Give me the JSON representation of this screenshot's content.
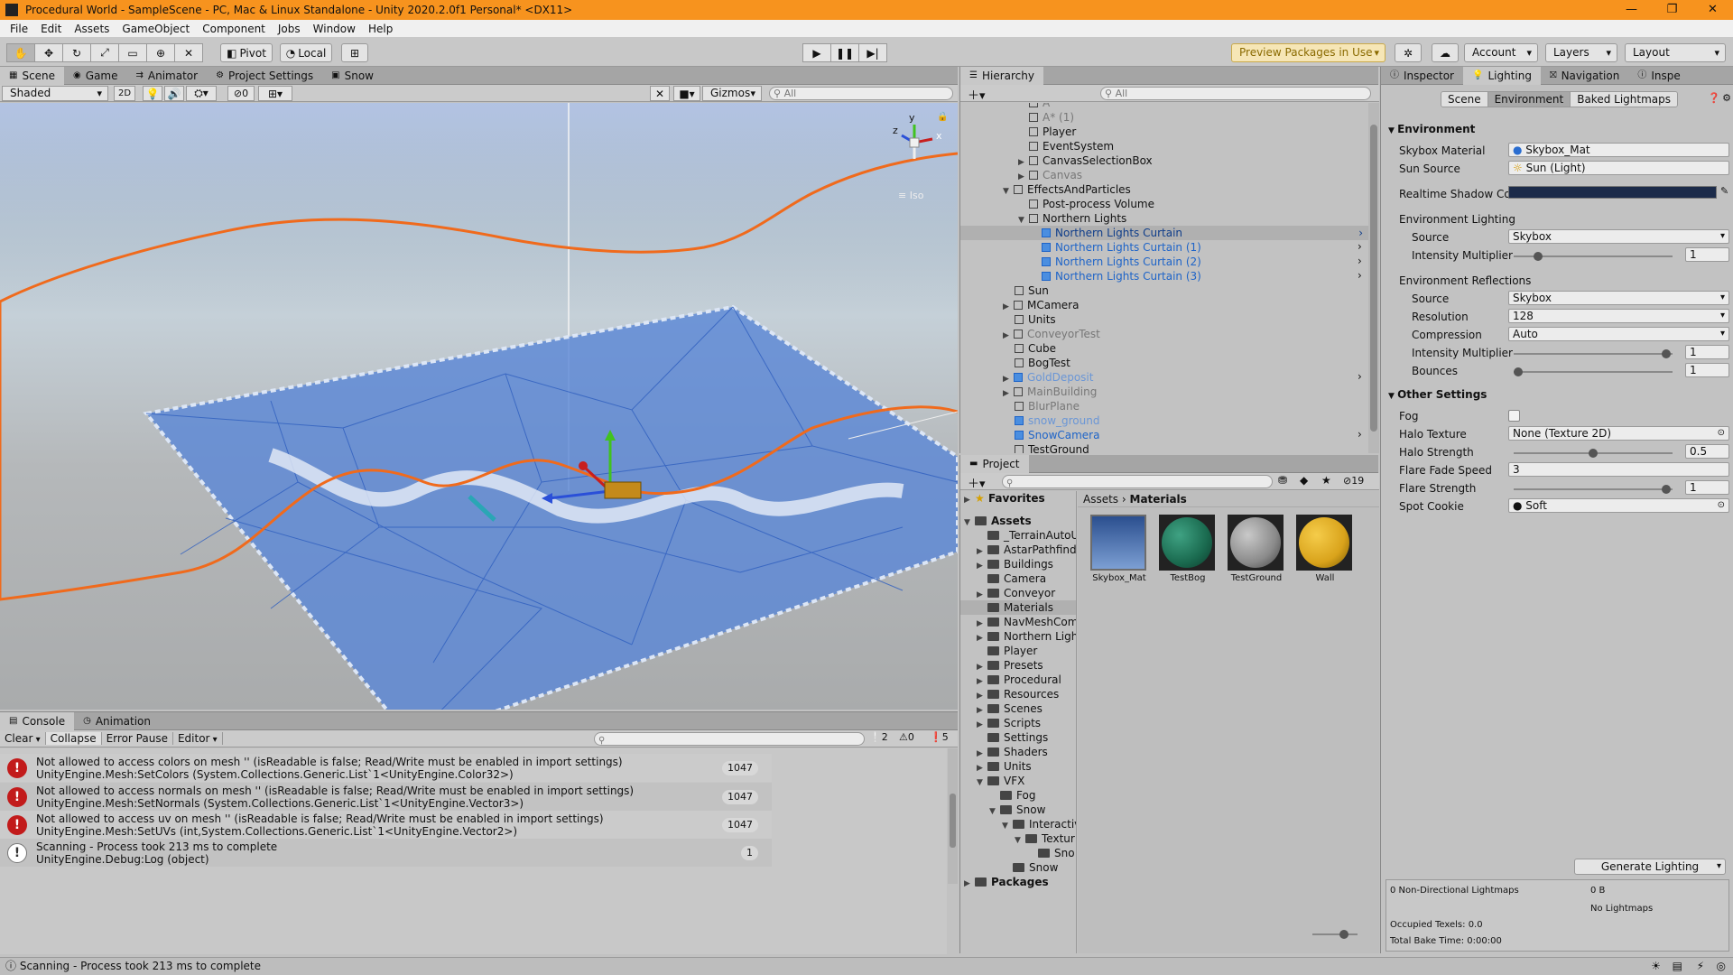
{
  "window": {
    "title": "Procedural World - SampleScene - PC, Mac & Linux Standalone - Unity 2020.2.0f1 Personal* <DX11>",
    "controls": [
      "—",
      "❐",
      "✕"
    ]
  },
  "menu": [
    "File",
    "Edit",
    "Assets",
    "GameObject",
    "Component",
    "Jobs",
    "Window",
    "Help"
  ],
  "toolbar": {
    "pivot": "Pivot",
    "local": "Local",
    "preview_packages": "Preview Packages in Use",
    "account": "Account",
    "layers": "Layers",
    "layout": "Layout"
  },
  "scene": {
    "tabs": [
      "Scene",
      "Game",
      "Animator",
      "Project Settings",
      "Snow"
    ],
    "shading": "Shaded",
    "mode2d": "2D",
    "hidden_count": "0",
    "gizmos": "Gizmos",
    "search_placeholder": "All",
    "iso": "Iso",
    "gizmo_axes": {
      "y": "y",
      "z": "z",
      "x": "x"
    }
  },
  "hierarchy": {
    "tab": "Hierarchy",
    "search_placeholder": "All",
    "items": [
      {
        "label": "A",
        "style": "faded"
      },
      {
        "label": "A* (1)",
        "style": "faded"
      },
      {
        "label": "Player",
        "style": "normal"
      },
      {
        "label": "EventSystem",
        "style": "normal"
      },
      {
        "label": "CanvasSelectionBox",
        "style": "normal"
      },
      {
        "label": "Canvas",
        "style": "faded"
      },
      {
        "label": "EffectsAndParticles",
        "style": "normal"
      },
      {
        "label": "Post-process Volume",
        "style": "normal"
      },
      {
        "label": "Northern Lights",
        "style": "normal"
      },
      {
        "label": "Northern Lights Curtain",
        "style": "prefab-selected"
      },
      {
        "label": "Northern Lights Curtain (1)",
        "style": "prefab"
      },
      {
        "label": "Northern Lights Curtain (2)",
        "style": "prefab"
      },
      {
        "label": "Northern Lights Curtain (3)",
        "style": "prefab"
      },
      {
        "label": "Sun",
        "style": "normal"
      },
      {
        "label": "MCamera",
        "style": "normal"
      },
      {
        "label": "Units",
        "style": "normal"
      },
      {
        "label": "ConveyorTest",
        "style": "faded"
      },
      {
        "label": "Cube",
        "style": "normal"
      },
      {
        "label": "BogTest",
        "style": "normal"
      },
      {
        "label": "GoldDeposit",
        "style": "prefab-faded"
      },
      {
        "label": "MainBuilding",
        "style": "faded"
      },
      {
        "label": "BlurPlane",
        "style": "faded"
      },
      {
        "label": "snow_ground",
        "style": "prefab-faded"
      },
      {
        "label": "SnowCamera",
        "style": "prefab"
      },
      {
        "label": "TestGround",
        "style": "normal"
      }
    ]
  },
  "project": {
    "tab": "Project",
    "hidden_count": "19",
    "favorites": "Favorites",
    "assets": "Assets",
    "packages": "Packages",
    "breadcrumb": [
      "Assets",
      "Materials"
    ],
    "folders": [
      "_TerrainAutoU",
      "AstarPathfindi",
      "Buildings",
      "Camera",
      "Conveyor",
      "Materials",
      "NavMeshCom",
      "Northern Light",
      "Player",
      "Presets",
      "Procedural",
      "Resources",
      "Scenes",
      "Scripts",
      "Settings",
      "Shaders",
      "Units",
      "VFX",
      "Fog",
      "Snow",
      "Interactiv",
      "Textur",
      "Sno",
      "Snow"
    ],
    "materials": [
      {
        "name": "Skybox_Mat",
        "color": "#3f6fb5"
      },
      {
        "name": "TestBog",
        "color": "#1f7a5c"
      },
      {
        "name": "TestGround",
        "color": "#8a8a8a"
      },
      {
        "name": "Wall",
        "color": "#d9a31b"
      }
    ]
  },
  "lighting": {
    "tabs": [
      "Inspector",
      "Lighting",
      "Navigation",
      "Inspe"
    ],
    "subtabs": [
      "Scene",
      "Environment",
      "Baked Lightmaps"
    ],
    "environment_header": "Environment",
    "skybox_material_label": "Skybox Material",
    "skybox_material": "Skybox_Mat",
    "sun_source_label": "Sun Source",
    "sun_source": "Sun (Light)",
    "shadow_color_label": "Realtime Shadow Col",
    "shadow_color": "#1c2b4a",
    "env_lighting_header": "Environment Lighting",
    "source_label": "Source",
    "source": "Skybox",
    "intensity_label": "Intensity Multiplier",
    "intensity": "1",
    "env_reflections_header": "Environment Reflections",
    "refl_source_label": "Source",
    "refl_source": "Skybox",
    "resolution_label": "Resolution",
    "resolution": "128",
    "compression_label": "Compression",
    "compression": "Auto",
    "refl_intensity_label": "Intensity Multiplier",
    "refl_intensity": "1",
    "bounces_label": "Bounces",
    "bounces": "1",
    "other_header": "Other Settings",
    "fog_label": "Fog",
    "halo_texture_label": "Halo Texture",
    "halo_texture": "None (Texture 2D)",
    "halo_strength_label": "Halo Strength",
    "halo_strength": "0.5",
    "flare_fade_label": "Flare Fade Speed",
    "flare_fade": "3",
    "flare_strength_label": "Flare Strength",
    "flare_strength": "1",
    "spot_cookie_label": "Spot Cookie",
    "spot_cookie": "Soft",
    "generate_button": "Generate Lighting",
    "stats": {
      "lightmaps": "0 Non-Directional Lightmaps",
      "size": "0 B",
      "no_lightmaps": "No Lightmaps",
      "occupied": "Occupied Texels: 0.0",
      "bake_time": "Total Bake Time: 0:00:00"
    }
  },
  "console": {
    "tabs": [
      "Console",
      "Animation"
    ],
    "buttons": [
      "Clear",
      "Collapse",
      "Error Pause",
      "Editor"
    ],
    "counts": {
      "info": "2",
      "warn": "0",
      "error": "5"
    },
    "entries": [
      {
        "type": "error",
        "line1": "Not allowed to access colors on mesh '' (isReadable is false; Read/Write must be enabled in import settings)",
        "line2": "UnityEngine.Mesh:SetColors (System.Collections.Generic.List`1<UnityEngine.Color32>)",
        "count": "1047"
      },
      {
        "type": "error",
        "line1": "Not allowed to access normals on mesh '' (isReadable is false; Read/Write must be enabled in import settings)",
        "line2": "UnityEngine.Mesh:SetNormals (System.Collections.Generic.List`1<UnityEngine.Vector3>)",
        "count": "1047"
      },
      {
        "type": "error",
        "line1": "Not allowed to access uv on mesh '' (isReadable is false; Read/Write must be enabled in import settings)",
        "line2": "UnityEngine.Mesh:SetUVs (int,System.Collections.Generic.List`1<UnityEngine.Vector2>)",
        "count": "1047"
      },
      {
        "type": "info",
        "line1": "Scanning - Process took 213 ms to complete",
        "line2": "UnityEngine.Debug:Log (object)",
        "count": "1"
      }
    ]
  },
  "statusbar": {
    "message": "Scanning - Process took 213 ms to complete"
  }
}
